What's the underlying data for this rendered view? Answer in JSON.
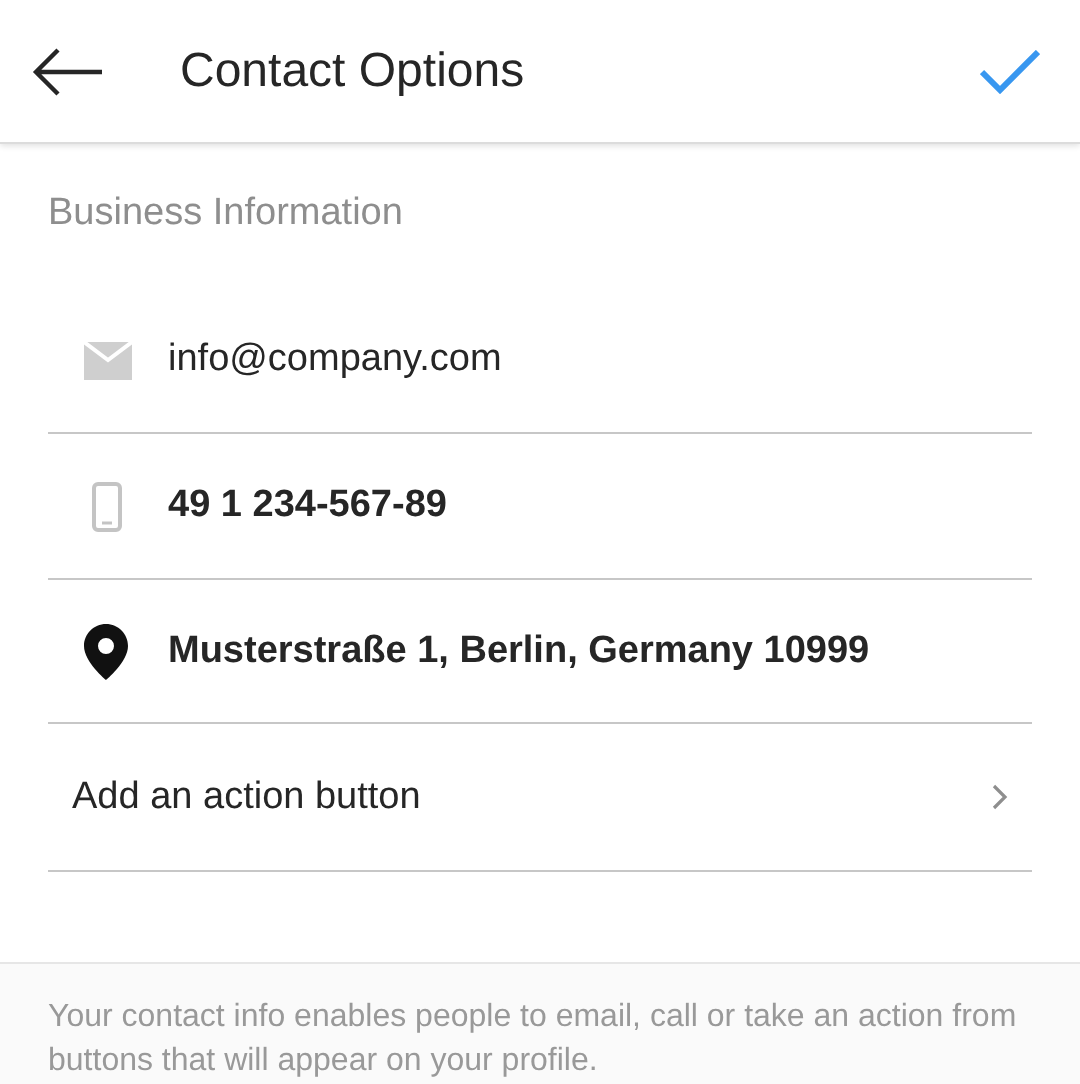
{
  "header": {
    "title": "Contact Options"
  },
  "section": {
    "title": "Business Information"
  },
  "fields": [
    {
      "kind": "email",
      "value": "info@company.com",
      "bold": false
    },
    {
      "kind": "phone",
      "value": "49 1 234-567-89",
      "bold": true
    },
    {
      "kind": "location",
      "value": "Musterstraße 1, Berlin, Germany 10999",
      "bold": true
    }
  ],
  "action": {
    "label": "Add an action button"
  },
  "footer": {
    "text": "Your contact info enables people to email, call or take an action from buttons that will appear on your profile."
  }
}
